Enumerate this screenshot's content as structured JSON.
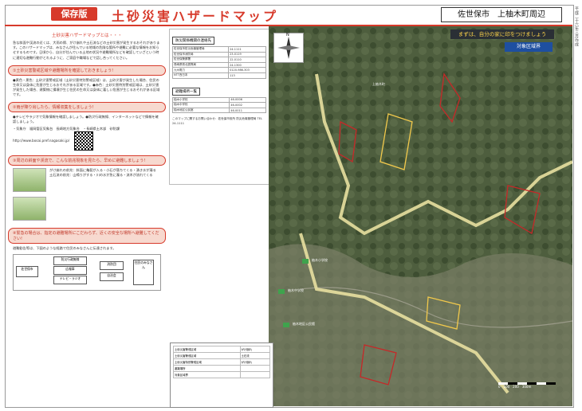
{
  "header": {
    "badge": "保存版",
    "title": "土砂災害ハザードマップ",
    "area": "佐世保市　上柚木町周辺",
    "side_date": "平成二十六年三月作成"
  },
  "left": {
    "intro_title": "土砂災害ハザードマップとは・・・",
    "intro_text": "急な斜面や渓流の近くは、大雨の際、がけ崩れや土石流などの土砂災害が発生するおそれがあります。このハザードマップは、みなさんが住んでいる地域の危険な箇所や避難に必要な情報をお知らせするものです。日頃から、自分が住んでいる土地の状況や避難場所などを確認していざという時に適切な避難行動がとれるように、ご家庭や職場などで話し合ってください。",
    "s1_head": "①土砂災害警戒区域や避難場所を確認しておきましょう!",
    "s1_text": "●黄色・黒色：土砂災害警戒区域（土砂災害特別警戒区域）は、土砂災害が発生した場合、住民の生命又は身体に危害が生じるおそれがある区域です。●赤色：土砂災害特別警戒区域は、土砂災害が発生した場合、建築物に損壊が生じ住民の生命又は身体に著しい危害が生じるおそれがある区域です。",
    "s2_head": "②雨が降り出したら、情報収集をしましょう!",
    "s2_text": "●テレビやラジオで気象情報を確認しましょう。●防災行政無線、インターネットなどで情報を確認しましょう。",
    "s2_links": "・気象庁　福岡管区気象台　長崎地方気象台　・長崎県土木部　砂防課　http://www.bosai.pref.nagasaki.jp/",
    "s3_head": "③周辺の斜面や渓流で、こんな前兆現象を見たら、早めに避難しましょう!",
    "s3_text": "がけ崩れの前兆：斜面に亀裂が入る・小石が落ちてくる・湧き水が濁る　土石流の前兆：山鳴りがする・川の水が急に濁る・流木が流れてくる",
    "s4_head": "④緊急の場合は、指定の避難場所にこだわらず、近くの安全な場所へ避難してください!",
    "s4_text": "避難勧告等は、下図のような経路で住民のみなさんに伝達されます。",
    "flow_labels": [
      "佐世保市",
      "防災行政無線",
      "広報車",
      "テレビ・ラジオ",
      "住民のみなさん",
      "消防団",
      "自治会"
    ]
  },
  "info": {
    "contact_title": "防災関係機関の連絡先",
    "contact_rows": [
      [
        "佐世保市防災危機管理局",
        "24-1111"
      ],
      [
        "佐世保市消防局",
        "23-0119"
      ],
      [
        "佐世保警察署",
        "22-0110"
      ],
      [
        "長崎県県北振興局",
        "24-1300"
      ],
      [
        "九州電力",
        "0120-986-303"
      ],
      [
        "NTT西日本",
        "113"
      ]
    ],
    "shelter_title": "避難場所一覧",
    "shelter_rows": [
      [
        "柚木小学校",
        "46-0006"
      ],
      [
        "柚木中学校",
        "46-0002"
      ],
      [
        "柚木地区公民館",
        "46-0011"
      ]
    ],
    "footnote": "このマップに関するお問い合わせ：佐世保市役所 防災危機管理局 TEL 24-1111"
  },
  "map": {
    "note": "まずは、自分の家に印をつけましょう",
    "target_label": "対象区域界",
    "compass_label": "N",
    "places": [
      "上柚木町",
      "柚木小学校",
      "柚木中学校",
      "柚木地区公民館"
    ],
    "scale": "0　100　200　300m"
  },
  "legend": {
    "rows": [
      [
        "土砂災害警戒区域",
        "がけ崩れ"
      ],
      [
        "土砂災害警戒区域",
        "土石流"
      ],
      [
        "土砂災害特別警戒区域",
        "がけ崩れ"
      ],
      [
        "避難場所",
        ""
      ],
      [
        "対象区域界",
        ""
      ]
    ]
  },
  "colors": {
    "accent": "#d73a2b",
    "boundary": "#e8e0a0",
    "hazard_red": "#c62828",
    "hazard_yellow": "#f2c94c"
  }
}
